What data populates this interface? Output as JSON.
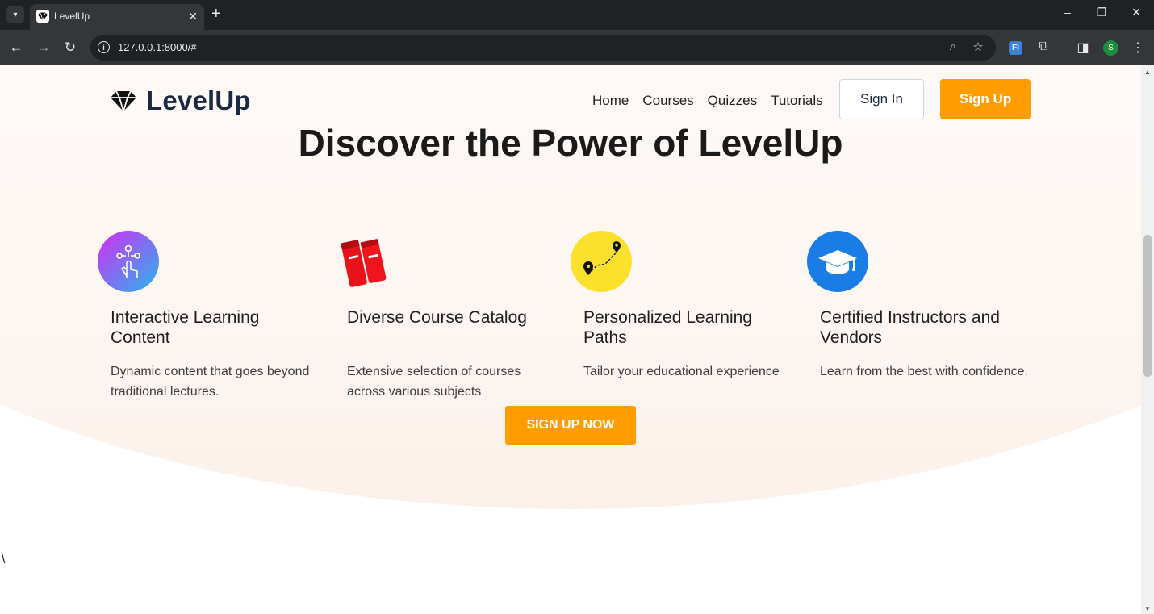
{
  "browser": {
    "tab_title": "LevelUp",
    "url": "127.0.0.1:8000/#",
    "profile_initial": "S",
    "extension_label": "FI"
  },
  "header": {
    "logo_text": "LevelUp",
    "nav": [
      "Home",
      "Courses",
      "Quizzes",
      "Tutorials"
    ],
    "signin_label": "Sign In",
    "signup_label": "Sign Up"
  },
  "hero": {
    "title": "Discover the Power of LevelUp"
  },
  "features": [
    {
      "title": "Interactive Learning Content",
      "description": "Dynamic content that goes beyond traditional lectures."
    },
    {
      "title": "Diverse Course Catalog",
      "description": "Extensive selection of courses across various subjects"
    },
    {
      "title": "Personalized Learning Paths",
      "description": "Tailor your educational experience"
    },
    {
      "title": "Certified Instructors and Vendors",
      "description": "Learn from the best with confidence."
    }
  ],
  "cta": {
    "label": "SIGN UP NOW"
  },
  "stray_text": "\\",
  "colors": {
    "accent": "#ff9d00",
    "logo": "#1b2a44"
  }
}
